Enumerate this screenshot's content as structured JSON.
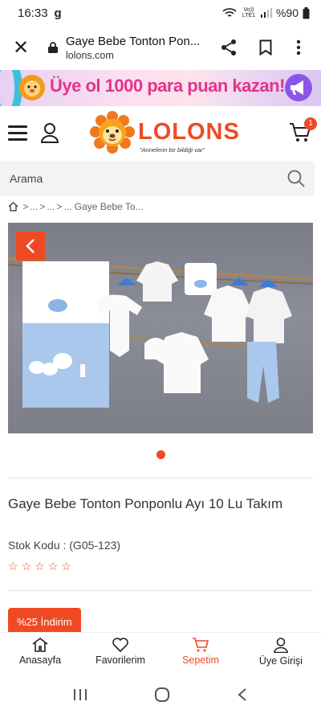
{
  "status_bar": {
    "time": "16:33",
    "app_glyph": "g",
    "network": "Vo)) LTE1",
    "battery": "%90"
  },
  "browser": {
    "page_title": "Gaye Bebe Tonton Pon...",
    "domain": "lolons.com"
  },
  "promo": {
    "text": "Üye ol 1000 para puan kazan!"
  },
  "header": {
    "brand": "LOLONS",
    "tagline": "\"Annelerin bir bildiği var\"",
    "cart_count": "1"
  },
  "search": {
    "placeholder": "Arama"
  },
  "breadcrumb": {
    "items": [
      "...",
      "...",
      "... Gaye Bebe To..."
    ]
  },
  "product": {
    "title": "Gaye Bebe Tonton Ponponlu Ayı 10 Lu Takım",
    "sku": "Stok Kodu : (G05-123)",
    "rating": 0,
    "rating_max": 5,
    "discount": "%25 İndirim"
  },
  "bottom_nav": [
    {
      "label": "Anasayfa",
      "icon": "home-icon"
    },
    {
      "label": "Favorilerim",
      "icon": "heart-icon"
    },
    {
      "label": "Sepetim",
      "icon": "cart-icon"
    },
    {
      "label": "Üye Girişi",
      "icon": "user-icon"
    }
  ],
  "colors": {
    "accent": "#ef4a23",
    "promo_text": "#e3348a"
  }
}
